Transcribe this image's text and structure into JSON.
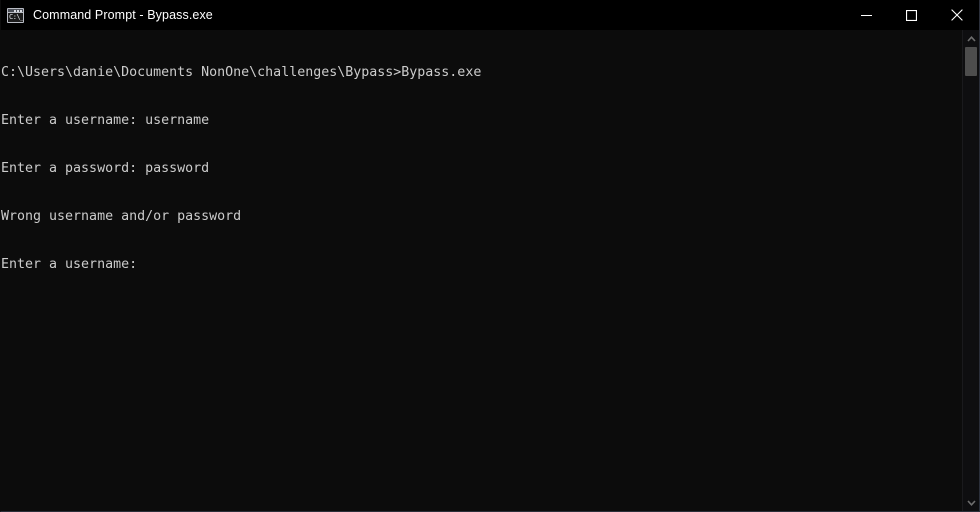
{
  "window": {
    "title": "Command Prompt - Bypass.exe",
    "icon": "cmd-icon",
    "icon_prompt_text": "C:\\_",
    "background_color": "#0C0C0C",
    "titlebar_color": "#000000",
    "text_color": "#CCCCCC"
  },
  "window_controls": {
    "minimize": {
      "name": "minimize-button",
      "glyph": "minimize-icon",
      "label": "Minimize"
    },
    "maximize": {
      "name": "maximize-button",
      "glyph": "maximize-icon",
      "label": "Maximize"
    },
    "close": {
      "name": "close-button",
      "glyph": "close-icon",
      "label": "Close"
    }
  },
  "terminal": {
    "lines": [
      "C:\\Users\\danie\\Documents NonOne\\challenges\\Bypass>Bypass.exe",
      "Enter a username: username",
      "Enter a password: password",
      "Wrong username and/or password",
      "Enter a username: "
    ]
  },
  "scrollbar": {
    "up_arrow": "chevron-up-icon",
    "down_arrow": "chevron-down-icon",
    "thumb_position_percent": 0,
    "thumb_color": "#4d4d4d"
  }
}
